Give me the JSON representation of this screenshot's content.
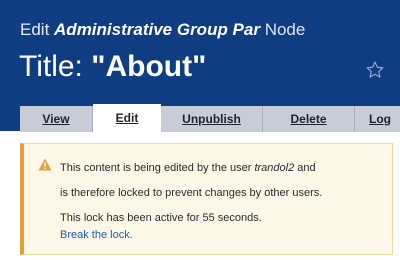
{
  "header": {
    "subtitle_prefix": "Edit",
    "content_type": "Administrative Group Par",
    "subtitle_suffix": "Node",
    "title_label": "Title:",
    "title_value": "\"About\"",
    "star_icon": "star-outline-icon",
    "background_color": "#0f3d82"
  },
  "tabs": [
    {
      "label": "View",
      "active": false
    },
    {
      "label": "Edit",
      "active": true
    },
    {
      "label": "Unpublish",
      "active": false
    },
    {
      "label": "Delete",
      "active": false
    },
    {
      "label": "Log",
      "active": false
    }
  ],
  "warning": {
    "icon": "warning-triangle-icon",
    "line1_before": "This content is being edited by the user ",
    "user": "trandol2",
    "line1_after": " and",
    "line2": "is therefore locked to prevent changes by other users.",
    "line3": "This lock has been active for 55 seconds.",
    "link": "Break the lock.",
    "accent_color": "#e3a03b"
  }
}
